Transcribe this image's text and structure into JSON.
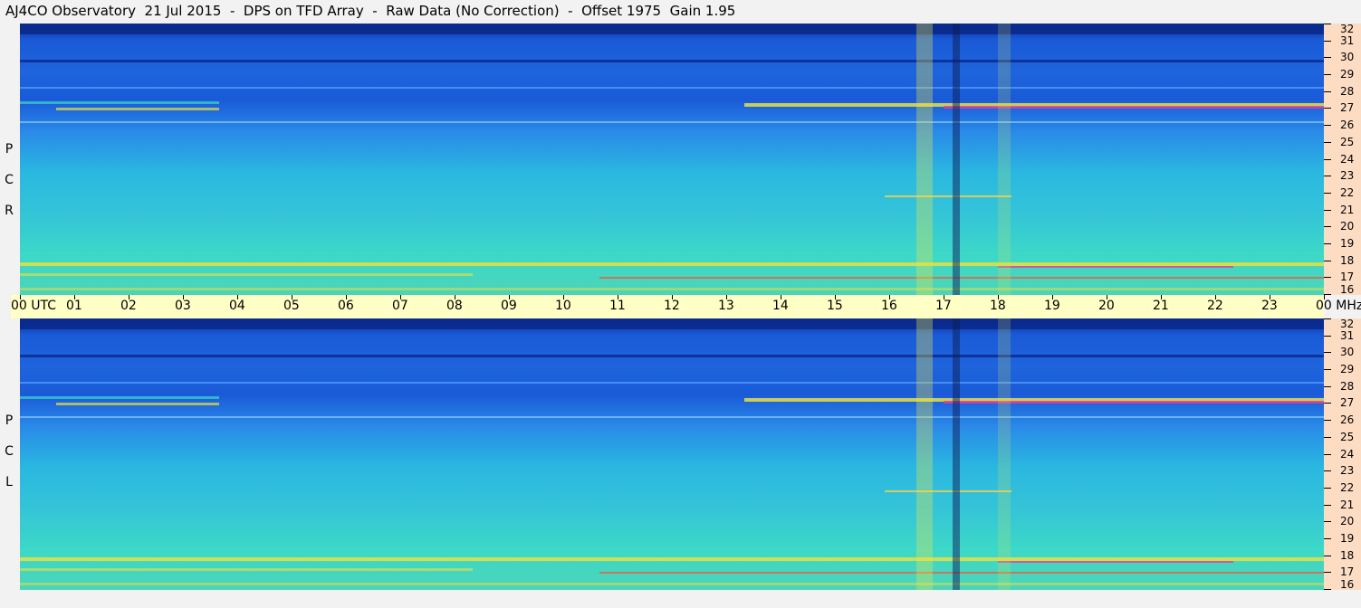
{
  "title": "AJ4CO Observatory  21 Jul 2015  -  DPS on TFD Array  -  Raw Data (No Correction)  -  Offset 1975  Gain 1.95",
  "time_axis": {
    "labels": [
      "00 UTC",
      "01",
      "02",
      "03",
      "04",
      "05",
      "06",
      "07",
      "08",
      "09",
      "10",
      "11",
      "12",
      "13",
      "14",
      "15",
      "16",
      "17",
      "18",
      "19",
      "20",
      "21",
      "22",
      "23",
      "00 MHz"
    ]
  },
  "freq_axis": {
    "labels": [
      "32",
      "31",
      "30",
      "29",
      "28",
      "27",
      "26",
      "25",
      "24",
      "23",
      "22",
      "21",
      "20",
      "19",
      "18",
      "17",
      "16"
    ]
  },
  "panels": [
    {
      "name": "rcp",
      "letters": [
        "P",
        "C",
        "R"
      ]
    },
    {
      "name": "lcp",
      "letters": [
        "P",
        "C",
        "L"
      ]
    }
  ],
  "colors": {
    "deep": "#0a2a8c",
    "blue": "#1a5ad8",
    "mid": "#2a8ae8",
    "cyan": "#2ab8e0",
    "aqua": "#3cd8c8",
    "yellow": "#e8e040",
    "magenta": "#e83ca0"
  },
  "chart_data": {
    "type": "heatmap",
    "x": [
      "00",
      "01",
      "02",
      "03",
      "04",
      "05",
      "06",
      "07",
      "08",
      "09",
      "10",
      "11",
      "12",
      "13",
      "14",
      "15",
      "16",
      "17",
      "18",
      "19",
      "20",
      "21",
      "22",
      "23",
      "00"
    ],
    "xlabel": "UTC",
    "y": [
      32,
      31,
      30,
      29,
      28,
      27,
      26,
      25,
      24,
      23,
      22,
      21,
      20,
      19,
      18,
      17,
      16
    ],
    "ylabel": "MHz",
    "series": [
      {
        "name": "RCP"
      },
      {
        "name": "LCP"
      }
    ]
  }
}
